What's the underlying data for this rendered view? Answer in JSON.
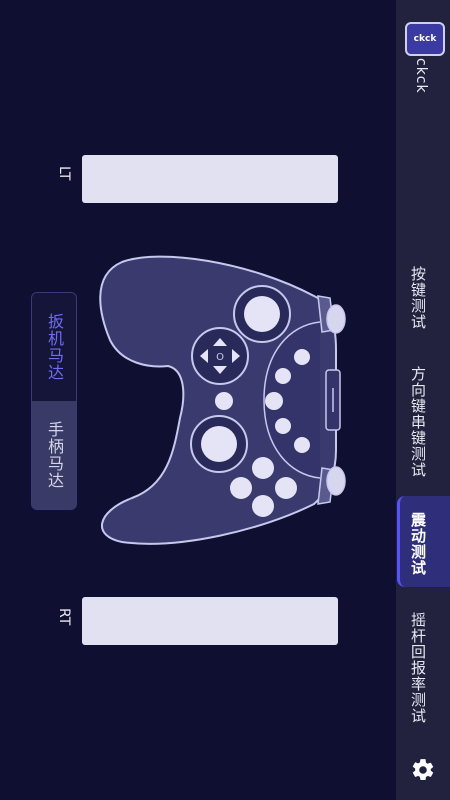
{
  "app": {
    "logo_text": "ckck",
    "name": "ckck"
  },
  "sidebar": {
    "items": [
      {
        "label": "按键测试"
      },
      {
        "label": "方向键串键测试"
      },
      {
        "label": "震动测试"
      },
      {
        "label": "摇杆回报率测试"
      }
    ],
    "active_index": 2
  },
  "triggers": {
    "left_label": "LT",
    "right_label": "RT",
    "left_value": 0,
    "right_value": 0
  },
  "motor": {
    "trigger_label": "扳机马达",
    "handle_label": "手柄马达",
    "selected": "扳机马达"
  },
  "dpad_center_label": "O",
  "colors": {
    "accent": "#5753ff",
    "background": "#0f0f32",
    "sidebar": "#22223e"
  }
}
